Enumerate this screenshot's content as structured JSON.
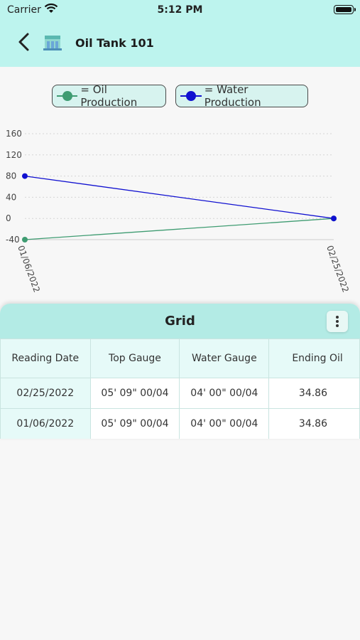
{
  "status": {
    "carrier": "Carrier",
    "time": "5:12 PM"
  },
  "nav": {
    "title": "Oil Tank 101",
    "back_icon": "chevron-left-icon",
    "tank_icon": "oil-tank-icon"
  },
  "legend": {
    "oil": {
      "label": "= Oil Production",
      "color": "#3f9c72"
    },
    "water": {
      "label": "= Water Production",
      "color": "#1010d0"
    }
  },
  "chart_data": {
    "type": "line",
    "categories": [
      "01/06/2022",
      "02/25/2022"
    ],
    "series": [
      {
        "name": "Oil Production",
        "color": "#3f9c72",
        "values": [
          -40,
          0
        ]
      },
      {
        "name": "Water Production",
        "color": "#1010d0",
        "values": [
          80,
          0
        ]
      }
    ],
    "ylim": [
      -40,
      160
    ],
    "yticks": [
      "160",
      "120",
      "80",
      "40",
      "0",
      "-40"
    ],
    "grid": true
  },
  "grid": {
    "title": "Grid",
    "menu_icon": "more-vertical-icon",
    "columns": [
      "Reading Date",
      "Top Gauge",
      "Water Gauge",
      "Ending Oil"
    ],
    "rows": [
      [
        "02/25/2022",
        "05' 09\" 00/04",
        "04' 00\" 00/04",
        "34.86"
      ],
      [
        "01/06/2022",
        "05' 09\" 00/04",
        "04' 00\" 00/04",
        "34.86"
      ]
    ]
  }
}
